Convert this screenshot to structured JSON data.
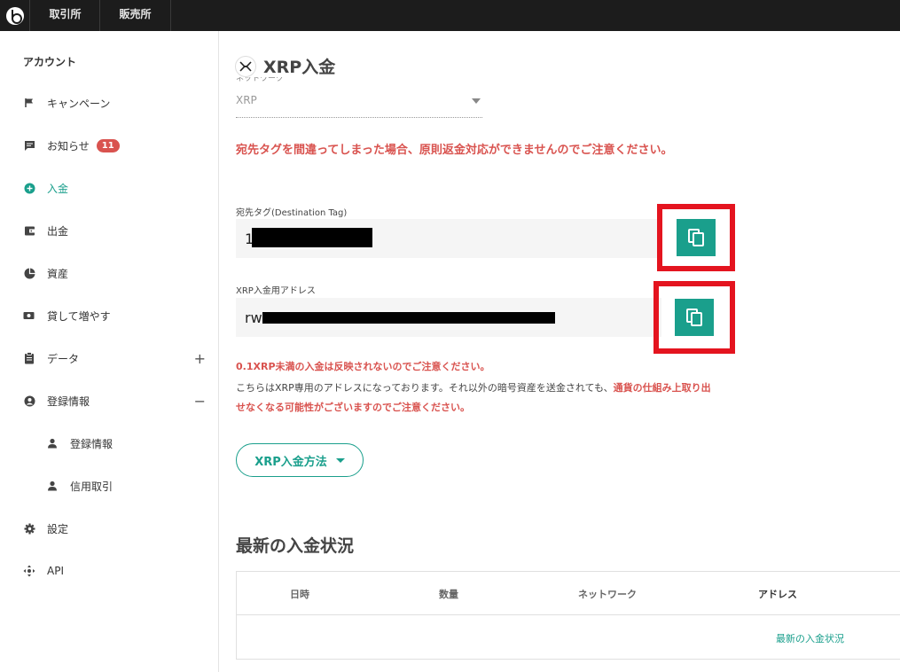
{
  "topbar": {
    "tabs": [
      "取引所",
      "販売所"
    ]
  },
  "sidebar": {
    "heading": "アカウント",
    "items": [
      {
        "label": "キャンペーン",
        "icon": "flag-icon"
      },
      {
        "label": "お知らせ",
        "icon": "message-icon",
        "badge": "11"
      },
      {
        "label": "入金",
        "icon": "plus-circle-icon",
        "active": true
      },
      {
        "label": "出金",
        "icon": "wallet-icon"
      },
      {
        "label": "資産",
        "icon": "pie-chart-icon"
      },
      {
        "label": "貸して増やす",
        "icon": "cash-icon"
      },
      {
        "label": "データ",
        "icon": "clipboard-icon",
        "toggle": "+"
      },
      {
        "label": "登録情報",
        "icon": "user-circle-icon",
        "toggle": "−"
      },
      {
        "label": "登録情報",
        "icon": "user-icon",
        "sub": true
      },
      {
        "label": "信用取引",
        "icon": "user-icon",
        "sub": true
      },
      {
        "label": "設定",
        "icon": "gear-icon"
      },
      {
        "label": "API",
        "icon": "api-icon"
      }
    ]
  },
  "main": {
    "title": "XRP入金",
    "network": {
      "label": "ネットワーク",
      "value": "XRP"
    },
    "warning": "宛先タグを間違ってしまった場合、原則返金対応ができませんのでご注意ください。",
    "destination_tag": {
      "label": "宛先タグ(Destination Tag)",
      "value_visible": "1"
    },
    "address": {
      "label": "XRP入金用アドレス",
      "value_visible": "rw"
    },
    "note1": "0.1XRP未満の入金は反映されないのでご注意ください。",
    "note2_plain": "こちらはXRP専用のアドレスになっております。それ以外の暗号資産を送金されても、",
    "note2_red": "通貨の仕組み上取り出せなくなる可能性がございますのでご注意ください。",
    "method_button": "XRP入金方法",
    "history": {
      "title": "最新の入金状況",
      "columns": [
        "日時",
        "数量",
        "ネットワーク",
        "アドレス"
      ],
      "link": "最新の入金状況"
    }
  },
  "colors": {
    "accent": "#1a9f8c",
    "warning": "#d9534f",
    "highlight": "#e4141f",
    "topbar": "#1c1c1c"
  }
}
